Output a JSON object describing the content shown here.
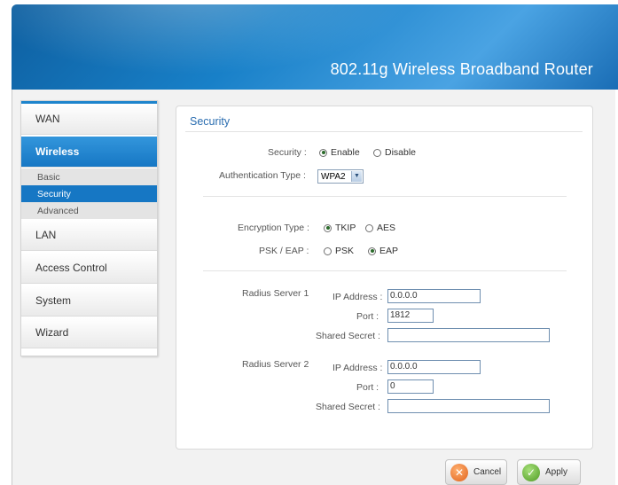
{
  "header": {
    "title": "802.11g Wireless Broadband Router"
  },
  "sidebar": {
    "items": [
      {
        "label": "WAN"
      },
      {
        "label": "Wireless"
      },
      {
        "label": "LAN"
      },
      {
        "label": "Access Control"
      },
      {
        "label": "System"
      },
      {
        "label": "Wizard"
      }
    ],
    "wireless_sub": [
      {
        "label": "Basic"
      },
      {
        "label": "Security"
      },
      {
        "label": "Advanced"
      }
    ],
    "active_item": "Wireless",
    "active_sub": "Security"
  },
  "panel": {
    "title": "Security",
    "security": {
      "label": "Security :",
      "enable": "Enable",
      "disable": "Disable",
      "selected": "Enable"
    },
    "auth": {
      "label": "Authentication Type :",
      "value": "WPA2"
    },
    "encryption": {
      "label": "Encryption Type :",
      "tkip": "TKIP",
      "aes": "AES",
      "selected": "TKIP"
    },
    "pskeap": {
      "label": "PSK / EAP :",
      "psk": "PSK",
      "eap": "EAP",
      "selected": "EAP"
    },
    "radius1": {
      "label": "Radius Server 1",
      "ip_label": "IP Address :",
      "ip": "0.0.0.0",
      "port_label": "Port :",
      "port": "1812",
      "secret_label": "Shared Secret :",
      "secret": ""
    },
    "radius2": {
      "label": "Radius Server 2",
      "ip_label": "IP Address :",
      "ip": "0.0.0.0",
      "port_label": "Port :",
      "port": "0",
      "secret_label": "Shared Secret :",
      "secret": ""
    }
  },
  "buttons": {
    "cancel": "Cancel",
    "apply": "Apply"
  },
  "colors": {
    "accent": "#1677c4",
    "cancel_icon": "#e8732a",
    "apply_icon": "#5aa02c"
  }
}
